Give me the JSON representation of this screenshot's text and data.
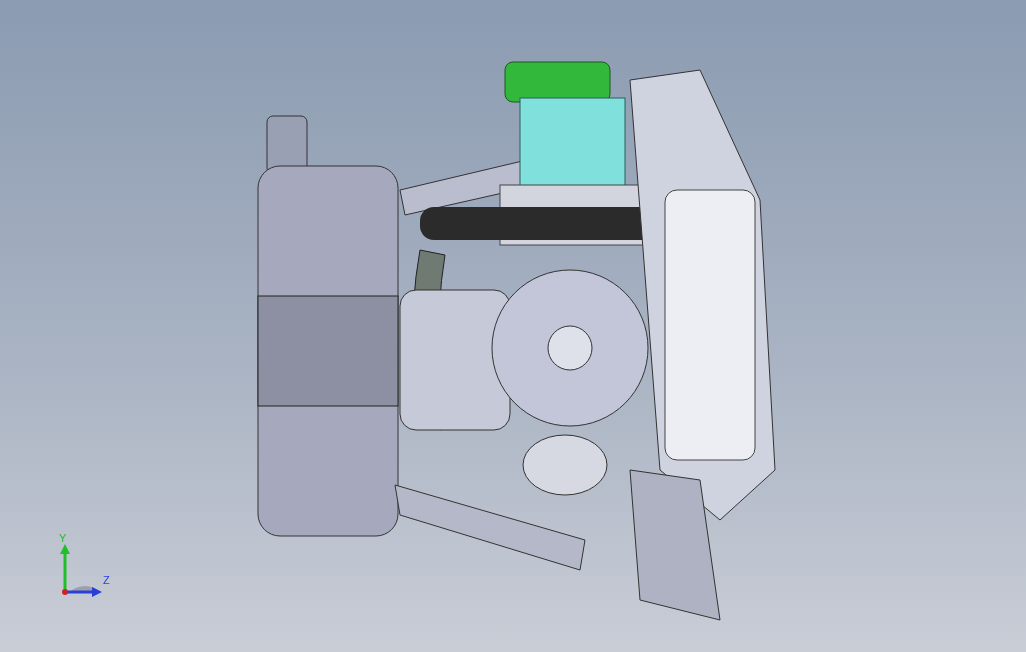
{
  "viewport": {
    "triad": {
      "axes": [
        {
          "label": "Y",
          "color": "#1fbf2a"
        },
        {
          "label": "Z",
          "color": "#2a3fd8"
        }
      ]
    }
  }
}
